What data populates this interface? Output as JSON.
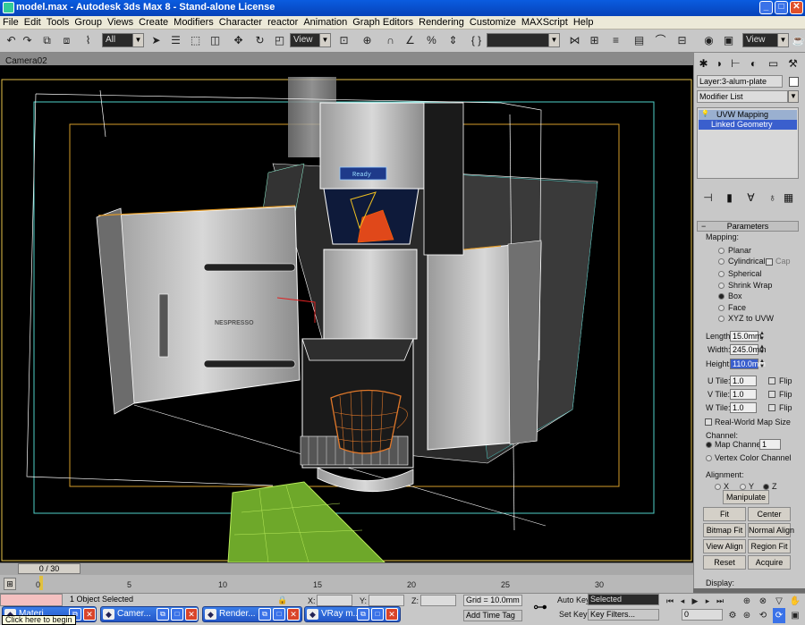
{
  "window": {
    "title": "model.max - Autodesk 3ds Max 8  - Stand-alone License",
    "min": "_",
    "max": "□",
    "close": "✕"
  },
  "menu": [
    "File",
    "Edit",
    "Tools",
    "Group",
    "Views",
    "Create",
    "Modifiers",
    "Character",
    "reactor",
    "Animation",
    "Graph Editors",
    "Rendering",
    "Customize",
    "MAXScript",
    "Help"
  ],
  "toolbar": {
    "selection_filter": "All",
    "ref_coord": "View",
    "named_sel": "",
    "view_combo": "View"
  },
  "viewport": {
    "label": "Camera02",
    "display_text": "Ready",
    "brand_text": "NESPRESSO"
  },
  "panel": {
    "layer": "Layer:3-alum-plate",
    "modifier_list": "Modifier List",
    "stack": [
      "UVW Mapping",
      "Linked Geometry"
    ],
    "parameters_title": "Parameters",
    "mapping_label": "Mapping:",
    "mapping_options": [
      "Planar",
      "Cylindrical",
      "Spherical",
      "Shrink Wrap",
      "Box",
      "Face",
      "XYZ to UVW"
    ],
    "mapping_selected": "Box",
    "cap_label": "Cap",
    "length_label": "Length:",
    "length": "15.0mm",
    "width_label": "Width:",
    "width": "245.0mm",
    "height_label": "Height:",
    "height": "110.0mm",
    "utile_label": "U Tile:",
    "utile": "1.0",
    "vtile_label": "V Tile:",
    "vtile": "1.0",
    "wtile_label": "W Tile:",
    "wtile": "1.0",
    "flip_label": "Flip",
    "realworld_label": "Real-World Map Size",
    "channel_label": "Channel:",
    "map_channel_label": "Map Channel:",
    "map_channel": "1",
    "vertex_color_label": "Vertex Color Channel",
    "alignment_label": "Alignment:",
    "axis": [
      "X",
      "Y",
      "Z"
    ],
    "axis_selected": "Z",
    "buttons": [
      "Manipulate",
      "Fit",
      "Center",
      "Bitmap Fit",
      "Normal Align",
      "View Align",
      "Region Fit",
      "Reset",
      "Acquire"
    ],
    "display_label": "Display:"
  },
  "timeline": {
    "slider": "0 / 30",
    "ticks": [
      "0",
      "5",
      "10",
      "15",
      "20",
      "25",
      "30"
    ]
  },
  "status": {
    "selected_text": "1 Object Selected",
    "x_label": "X:",
    "y_label": "Y:",
    "z_label": "Z:",
    "grid": "Grid = 10.0mm",
    "add_time_tag": "Add Time Tag",
    "auto_key": "Auto Key",
    "set_key": "Set Key",
    "selected_combo": "Selected",
    "key_filters": "Key Filters...",
    "frame": "0"
  },
  "taskbar": {
    "items": [
      "Materi...",
      "Camer...",
      "Render...",
      "VRay m..."
    ],
    "tooltip": "Click here to begin"
  },
  "colors": {
    "titlebar": "#0a5ce0",
    "selection": "#3a5fcd",
    "viewport_bg": "#000000"
  }
}
